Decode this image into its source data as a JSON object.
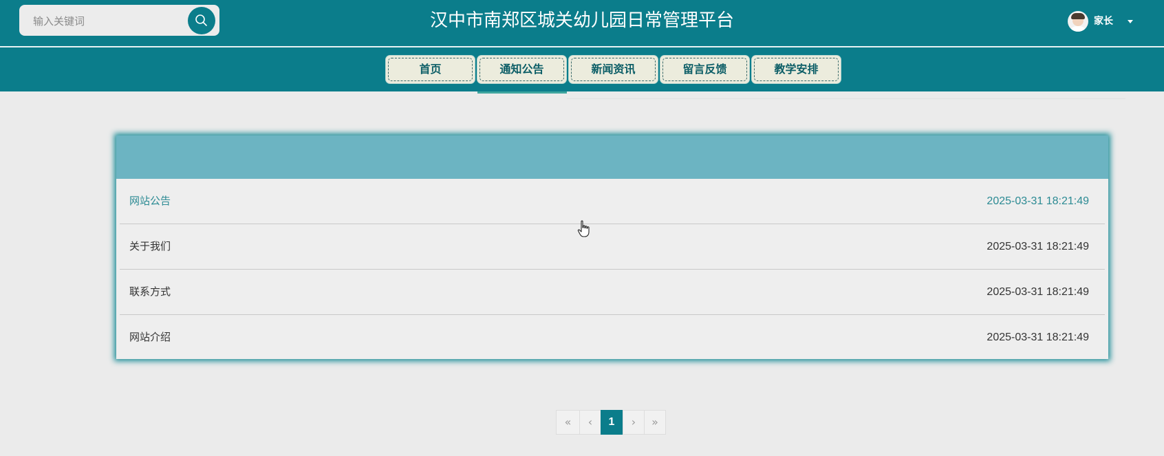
{
  "search": {
    "placeholder": "输入关键词"
  },
  "header": {
    "site_title": "汉中市南郑区城关幼儿园日常管理平台",
    "user_name": "家长"
  },
  "nav": {
    "items": [
      {
        "label": "首页"
      },
      {
        "label": "通知公告"
      },
      {
        "label": "新闻资讯"
      },
      {
        "label": "留言反馈"
      },
      {
        "label": "教学安排"
      }
    ],
    "active_index": 1
  },
  "notices": [
    {
      "title": "网站公告",
      "time": "2025-03-31 18:21:49"
    },
    {
      "title": "关于我们",
      "time": "2025-03-31 18:21:49"
    },
    {
      "title": "联系方式",
      "time": "2025-03-31 18:21:49"
    },
    {
      "title": "网站介绍",
      "time": "2025-03-31 18:21:49"
    }
  ],
  "pagination": {
    "first": "«",
    "prev": "‹",
    "current": "1",
    "next": "›",
    "last": "»"
  },
  "colors": {
    "primary": "#0b7d8b",
    "panel_header": "#6cb4c2",
    "nav_button_bg": "#ececdd",
    "page_bg": "#ebebeb"
  }
}
